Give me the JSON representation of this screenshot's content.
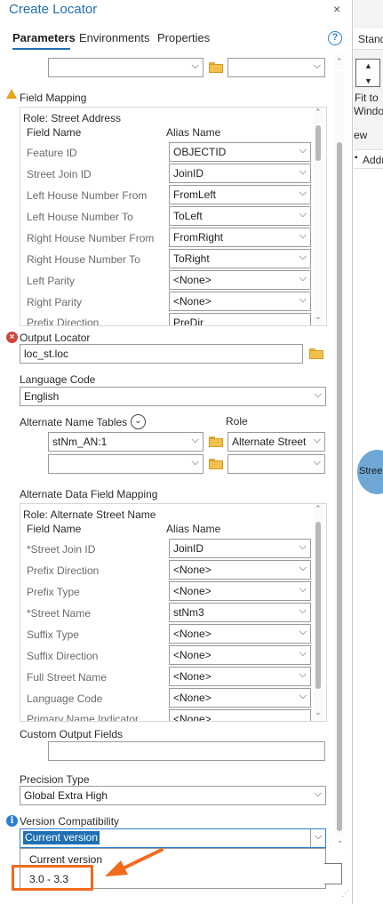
{
  "pane": {
    "title": "Create Locator",
    "close": "×"
  },
  "tabs": [
    {
      "label": "Parameters"
    },
    {
      "label": "Environments"
    },
    {
      "label": "Properties"
    }
  ],
  "help": "?",
  "top_row": {
    "left_value": "",
    "right_value": ""
  },
  "field_mapping": {
    "header": "Field Mapping",
    "role": "Role: Street Address",
    "col_field": "Field Name",
    "col_alias": "Alias Name",
    "rows": [
      {
        "field": "Feature ID",
        "alias": "OBJECTID"
      },
      {
        "field": "Street Join ID",
        "alias": "JoinID"
      },
      {
        "field": "Left House Number From",
        "alias": "FromLeft"
      },
      {
        "field": "Left House Number To",
        "alias": "ToLeft"
      },
      {
        "field": "Right House Number From",
        "alias": "FromRight"
      },
      {
        "field": "Right House Number To",
        "alias": "ToRight"
      },
      {
        "field": "Left Parity",
        "alias": "<None>"
      },
      {
        "field": "Right Parity",
        "alias": "<None>"
      },
      {
        "field": "Prefix Direction",
        "alias": "PreDir"
      }
    ]
  },
  "output_locator": {
    "label": "Output Locator",
    "value": "loc_st.loc"
  },
  "language_code": {
    "label": "Language Code",
    "value": "English"
  },
  "alternate_name_tables": {
    "label": "Alternate Name Tables",
    "role_label": "Role",
    "rows": [
      {
        "table": "stNm_AN:1",
        "role": "Alternate Street"
      },
      {
        "table": "",
        "role": ""
      }
    ]
  },
  "alt_field_mapping": {
    "header": "Alternate Data Field Mapping",
    "role": "Role: Alternate Street Name",
    "col_field": "Field Name",
    "col_alias": "Alias Name",
    "rows": [
      {
        "field": "*Street Join ID",
        "alias": "JoinID"
      },
      {
        "field": "Prefix Direction",
        "alias": "<None>"
      },
      {
        "field": "Prefix Type",
        "alias": "<None>"
      },
      {
        "field": "*Street Name",
        "alias": "stNm3"
      },
      {
        "field": "Suffix Type",
        "alias": "<None>"
      },
      {
        "field": "Suffix Direction",
        "alias": "<None>"
      },
      {
        "field": "Full Street Name",
        "alias": "<None>"
      },
      {
        "field": "Language Code",
        "alias": "<None>"
      },
      {
        "field": "Primary Name Indicator",
        "alias": "<None>"
      }
    ]
  },
  "custom_output_fields": {
    "label": "Custom Output Fields",
    "value": ""
  },
  "precision_type": {
    "label": "Precision Type",
    "value": "Global Extra High"
  },
  "version_compat": {
    "label": "Version Compatibility",
    "value": "Current version",
    "options": [
      "Current version",
      "3.0 - 3.3"
    ]
  },
  "right_panel": {
    "tab": "Stand",
    "fit_label_1": "Fit to",
    "fit_label_2": "Window",
    "view": "ew",
    "addr": "Addr",
    "street_badge": "Stree"
  },
  "colors": {
    "accent": "#1f6fb2",
    "highlight": "#f26b1d",
    "error": "#d2453d",
    "warning": "#e8a317"
  }
}
